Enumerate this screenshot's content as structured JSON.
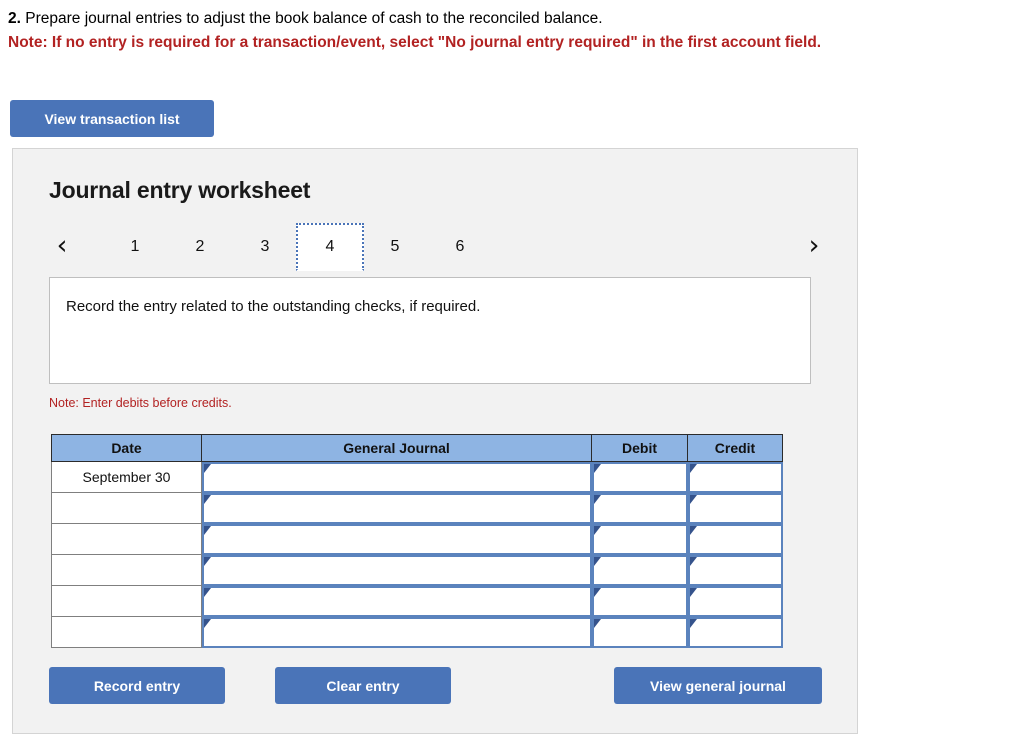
{
  "prompt": {
    "number": "2.",
    "text": "Prepare journal entries to adjust the book balance of cash to the reconciled balance.",
    "note": "Note: If no entry is required for a transaction/event, select \"No journal entry required\" in the first account field."
  },
  "toolbar": {
    "view_transaction_list": "View transaction list"
  },
  "worksheet": {
    "title": "Journal entry worksheet",
    "pager": {
      "prev_icon": "chevron-left-icon",
      "prev_glyph": "‹",
      "next_icon": "chevron-right-icon",
      "next_glyph": "›",
      "tabs": [
        "1",
        "2",
        "3",
        "4",
        "5",
        "6"
      ],
      "active": "4"
    },
    "question": "Record the entry related to the outstanding checks, if required.",
    "debit_note": "Note: Enter debits before credits.",
    "table": {
      "headers": [
        "Date",
        "General Journal",
        "Debit",
        "Credit"
      ],
      "rows": [
        {
          "date": "September 30",
          "general_journal": "",
          "debit": "",
          "credit": ""
        },
        {
          "date": "",
          "general_journal": "",
          "debit": "",
          "credit": ""
        },
        {
          "date": "",
          "general_journal": "",
          "debit": "",
          "credit": ""
        },
        {
          "date": "",
          "general_journal": "",
          "debit": "",
          "credit": ""
        },
        {
          "date": "",
          "general_journal": "",
          "debit": "",
          "credit": ""
        },
        {
          "date": "",
          "general_journal": "",
          "debit": "",
          "credit": ""
        }
      ]
    },
    "actions": {
      "record_entry": "Record entry",
      "clear_entry": "Clear entry",
      "view_general_journal": "View general journal"
    }
  },
  "colors": {
    "button_blue": "#4a74b8",
    "header_blue": "#8eb4e3",
    "cell_border_blue": "#5b83bd",
    "note_red": "#b22222",
    "panel_bg": "#f2f2f2"
  }
}
